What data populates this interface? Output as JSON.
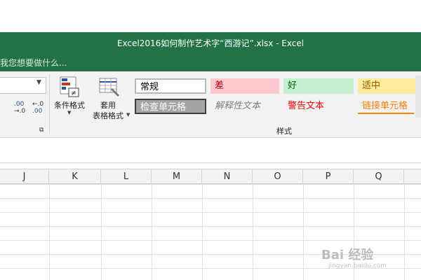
{
  "window": {
    "title": "Excel2016如何制作艺术字“西游记”.xlsx - Excel",
    "tell_me": "我您想要做什么..."
  },
  "ribbon": {
    "conditional_formatting": "条件格式",
    "format_as_table_line1": "套用",
    "format_as_table_line2": "表格格式",
    "styles_group_label": "样式",
    "decimal_increase": ".00",
    "decimal_increase_sub": "→.0",
    "decimal_decrease": "←.0",
    "decimal_decrease_sub": ".00",
    "cell_styles": [
      {
        "label": "常规",
        "bg": "#ffffff",
        "color": "#000000"
      },
      {
        "label": "差",
        "bg": "#ffc7ce",
        "color": "#9c0006"
      },
      {
        "label": "好",
        "bg": "#c6efce",
        "color": "#006100"
      },
      {
        "label": "适中",
        "bg": "#ffeb9c",
        "color": "#9c5700"
      },
      {
        "label": "检查单元格",
        "bg": "#a5a5a5",
        "color": "#ffffff"
      },
      {
        "label": "解释性文本",
        "bg": "#ffffff",
        "color": "#7f7f7f"
      },
      {
        "label": "警告文本",
        "bg": "#ffffff",
        "color": "#ff0000"
      },
      {
        "label": "链接单元格",
        "bg": "#ffffff",
        "color": "#fa7d00"
      }
    ]
  },
  "columns": [
    "J",
    "K",
    "L",
    "M",
    "N",
    "O",
    "P",
    "Q"
  ],
  "watermark": {
    "text": "Bai 经验",
    "sub": "jingyan.baidu.com"
  },
  "colors": {
    "excel_green": "#217346",
    "ribbon_bg": "#f3f3f3"
  }
}
